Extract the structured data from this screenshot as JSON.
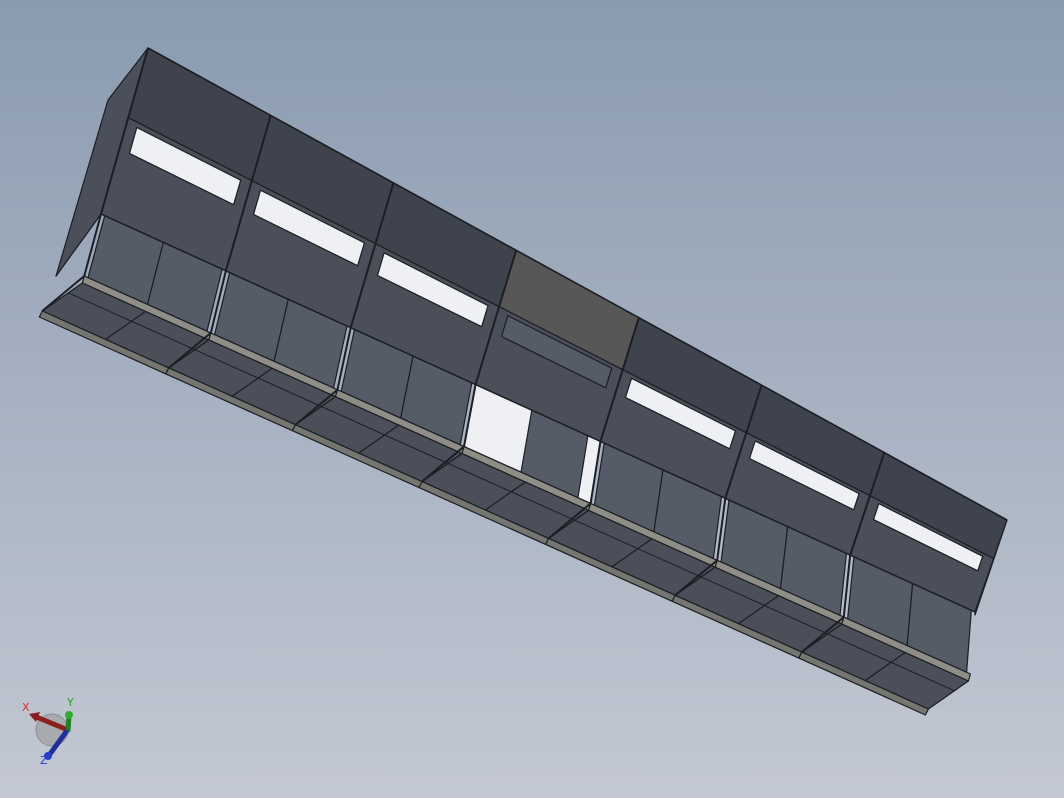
{
  "viewport": {
    "background_top": "#8a9bb0",
    "background_bottom": "#c3c8d3"
  },
  "model": {
    "name": "cabinet-row-assembly",
    "bay_count": 7,
    "highlighted_bay": 4,
    "colors": {
      "panel_face": "#565b68",
      "panel_dark": "#3f434e",
      "panel_shadow": "#4b4f5a",
      "highlight_face": "#575757",
      "frame_rail": "#767670",
      "frame_rail_light": "#8e8e86",
      "edge_line": "#1c1e24",
      "opening": "#eef0f4"
    }
  },
  "triad": {
    "x_label": "X",
    "y_label": "Y",
    "z_label": "Z",
    "x_color": "#d0302a",
    "y_color": "#27a02b",
    "z_color": "#2a3fc8",
    "sphere_color": "#a9aab0"
  }
}
